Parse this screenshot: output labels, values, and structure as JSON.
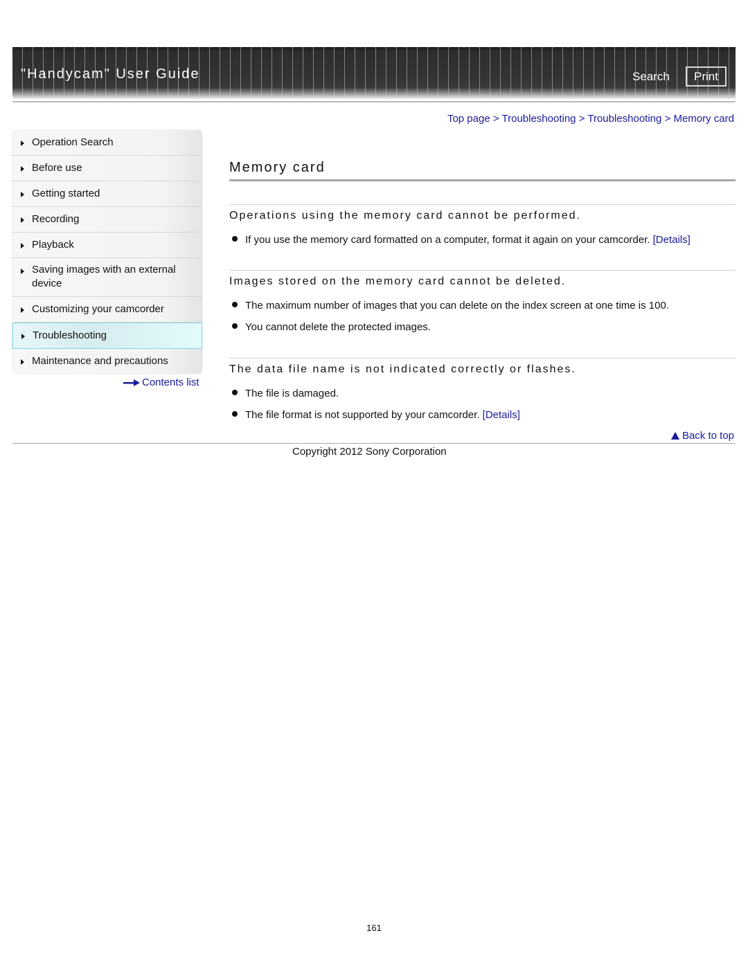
{
  "header": {
    "title": "\"Handycam\" User Guide",
    "search_label": "Search",
    "print_label": "Print"
  },
  "breadcrumb": {
    "items": [
      "Top page",
      "Troubleshooting",
      "Troubleshooting",
      "Memory card"
    ],
    "separator": ">"
  },
  "sidebar": {
    "items": [
      {
        "label": "Operation Search"
      },
      {
        "label": "Before use"
      },
      {
        "label": "Getting started"
      },
      {
        "label": "Recording"
      },
      {
        "label": "Playback"
      },
      {
        "label": "Saving images with an external device"
      },
      {
        "label": "Customizing your camcorder"
      },
      {
        "label": "Troubleshooting",
        "active": true
      },
      {
        "label": "Maintenance and precautions"
      }
    ],
    "contents_link": "Contents list"
  },
  "main": {
    "title": "Memory card",
    "sections": [
      {
        "heading": "Operations using the memory card cannot be performed.",
        "bullets": [
          {
            "text": "If you use the memory card formatted on a computer, format it again on your camcorder.",
            "link": "[Details]"
          }
        ]
      },
      {
        "heading": "Images stored on the memory card cannot be deleted.",
        "bullets": [
          {
            "text": "The maximum number of images that you can delete on the index screen at one time is 100."
          },
          {
            "text": "You cannot delete the protected images."
          }
        ]
      },
      {
        "heading": "The data file name is not indicated correctly or flashes.",
        "bullets": [
          {
            "text": "The file is damaged."
          },
          {
            "text": "The file format is not supported by your camcorder.",
            "link": "[Details]"
          }
        ]
      }
    ],
    "back_to_top": "Back to top"
  },
  "footer": {
    "copyright": "Copyright 2012 Sony Corporation",
    "page_number": "161"
  },
  "colors": {
    "link": "#1a1a9c",
    "header_bg": "#333333",
    "active_nav_border": "#7fd6e4"
  }
}
